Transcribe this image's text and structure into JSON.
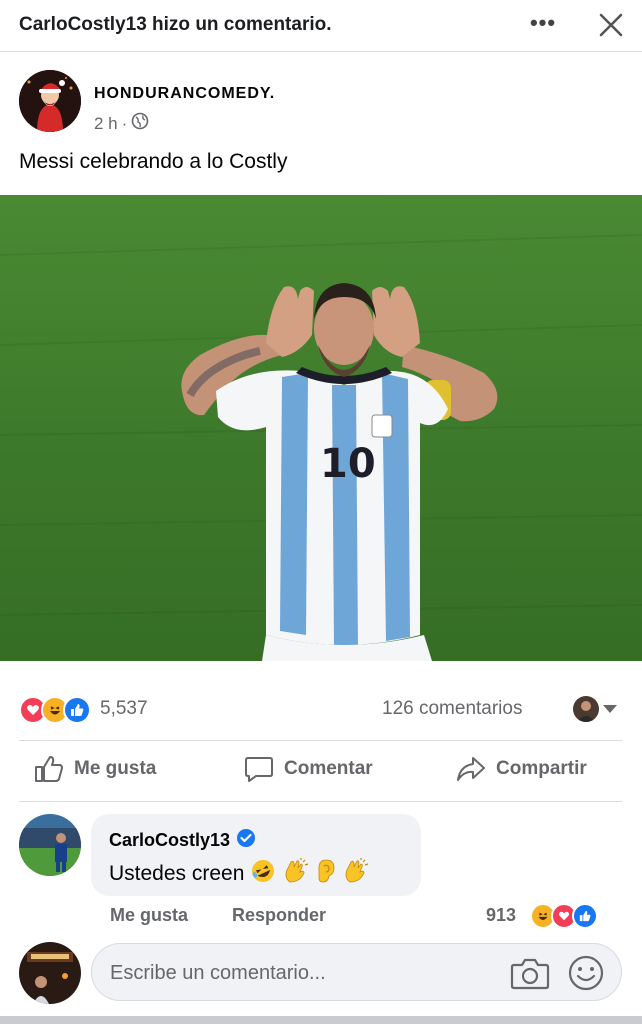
{
  "header": {
    "title": "CarloCostly13 hizo un comentario.",
    "more_icon": "more-horizontal-icon",
    "close_icon": "close-icon"
  },
  "post": {
    "page_name": "HONDURANCOMEDY.",
    "time": "2 h",
    "separator": "·",
    "audience_icon": "globe-icon",
    "caption": "Messi celebrando a lo Costly",
    "jersey_number": "10"
  },
  "stats": {
    "reactions": [
      "love",
      "haha",
      "like"
    ],
    "reaction_count": "5,537",
    "comment_count": "126 comentarios"
  },
  "actions": {
    "like": "Me gusta",
    "comment": "Comentar",
    "share": "Compartir"
  },
  "comment": {
    "author": "CarloCostly13",
    "verified": true,
    "text": "Ustedes creen",
    "emojis": [
      "rolling-laughing",
      "clapping-hands",
      "ear",
      "clapping-hands"
    ],
    "like_label": "Me gusta",
    "reply_label": "Responder",
    "reaction_count": "913",
    "reactions": [
      "haha",
      "love",
      "like"
    ]
  },
  "composer": {
    "placeholder": "Escribe un comentario...",
    "camera_icon": "camera-icon",
    "emoji_icon": "smiley-icon"
  },
  "colors": {
    "like_blue": "#1877f2",
    "love_red": "#f33e58",
    "haha_yellow": "#f7b125",
    "secondary_text": "#65676b",
    "bubble_bg": "#f0f2f5"
  }
}
